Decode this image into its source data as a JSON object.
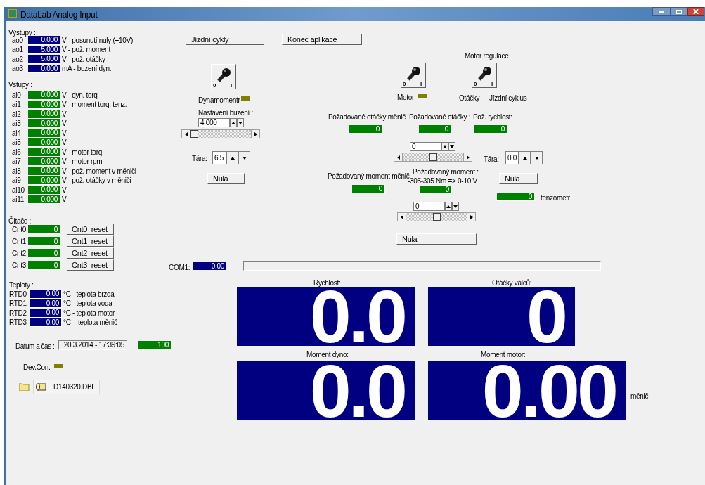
{
  "window": {
    "title": "DataLab Analog Input"
  },
  "outputs": {
    "heading": "Výstupy :",
    "rows": [
      {
        "name": "ao0",
        "value": "0.000",
        "unit": "V - posunutí nuly (+10V)"
      },
      {
        "name": "ao1",
        "value": "5.000",
        "unit": "V - pož. moment"
      },
      {
        "name": "ao2",
        "value": "5.000",
        "unit": "V - pož. otáčky"
      },
      {
        "name": "ao3",
        "value": "0.000",
        "unit": "mA - buzení dyn."
      }
    ]
  },
  "inputs": {
    "heading": "Vstupy :",
    "rows": [
      {
        "name": "ai0",
        "value": "0.000",
        "unit": "V - dyn. torq"
      },
      {
        "name": "ai1",
        "value": "0.000",
        "unit": "V - moment torq. tenz."
      },
      {
        "name": "ai2",
        "value": "0.000",
        "unit": "V"
      },
      {
        "name": "ai3",
        "value": "0.000",
        "unit": "V"
      },
      {
        "name": "ai4",
        "value": "0.000",
        "unit": "V"
      },
      {
        "name": "ai5",
        "value": "0.000",
        "unit": "V"
      },
      {
        "name": "ai6",
        "value": "0.000",
        "unit": "V - motor torq"
      },
      {
        "name": "ai7",
        "value": "0.000",
        "unit": "V - motor rpm"
      },
      {
        "name": "ai8",
        "value": "0.000",
        "unit": "V - pož. moment v měniči"
      },
      {
        "name": "ai9",
        "value": "0.000",
        "unit": "V - pož. otáčky v měniči"
      },
      {
        "name": "ai10",
        "value": "0.000",
        "unit": "V"
      },
      {
        "name": "ai11",
        "value": "0.000",
        "unit": "V"
      }
    ]
  },
  "counters": {
    "heading": "Čítače :",
    "rows": [
      {
        "name": "Cnt0",
        "value": "0",
        "button": "Cnt0_reset"
      },
      {
        "name": "Cnt1",
        "value": "0",
        "button": "Cnt1_reset"
      },
      {
        "name": "Cnt2",
        "value": "0",
        "button": "Cnt2_reset"
      },
      {
        "name": "Cnt3",
        "value": "0",
        "button": "Cnt3_reset"
      }
    ]
  },
  "temperatures": {
    "heading": "Teploty :",
    "rows": [
      {
        "name": "RTD0",
        "value": "0.00",
        "unit": "°C - teplota brzda"
      },
      {
        "name": "RTD1",
        "value": "0.00",
        "unit": "°C - teplota voda"
      },
      {
        "name": "RTD2",
        "value": "0.00",
        "unit": "°C - teplota motor"
      },
      {
        "name": "RTD3",
        "value": "0.00",
        "unit": "°C  - teplota měnič"
      }
    ]
  },
  "datetime": {
    "label": "Datum a čas :",
    "value": "20.3.2014 - 17:39:05",
    "counter": "100"
  },
  "device": {
    "label": "Dev.Con.",
    "on": false
  },
  "file": {
    "name": "D140320.DBF"
  },
  "buttons": [
    {
      "label": "Jízdní cykly"
    },
    {
      "label": "Konec aplikace"
    }
  ],
  "dynamometer": {
    "switch": {
      "on": false,
      "off_label": "0",
      "on_label": "I"
    },
    "label": "Dynamomentr",
    "on": false,
    "excitation_label": "Nastavení buzení :",
    "excitation_value": "4.000",
    "tare_label": "Tára:",
    "tare_value": "6.5",
    "zero_button": "Nula"
  },
  "motor": {
    "regulation_label": "Motor regulace",
    "switch": {
      "on": false,
      "off_label": "0",
      "on_label": "I"
    },
    "regulation_switch": {
      "on": false,
      "off_label": "0",
      "on_label": "I"
    },
    "label": "Motor",
    "on": false,
    "mode_labels": [
      "Otáčky",
      "Jízdní cyklus"
    ]
  },
  "readouts": [
    {
      "label": "Požadované otáčky měnič",
      "value": "0"
    },
    {
      "label": "Požadované otáčky :",
      "value": "0"
    },
    {
      "label": "Pož. rychlost:",
      "value": "0"
    }
  ],
  "speed_setpoint": {
    "value": "0"
  },
  "tare": {
    "label": "Tára:",
    "value": "0.0"
  },
  "torque": {
    "inverter_label": "Požadovaný moment měnič",
    "inverter_value": "0",
    "label": "Požadovaný moment :",
    "range": "-305-305 Nm => 0-10 V",
    "value": "0",
    "setpoint": "0",
    "zero_button": "Nula"
  },
  "tenzometer": {
    "zero_button": "Nula",
    "value": "0",
    "label": "tenzometr"
  },
  "com": {
    "label": "COM1:",
    "value": "0.00"
  },
  "displays": [
    {
      "label": "Rychlost:",
      "value": "0.0"
    },
    {
      "label": "Otáčky válců:",
      "value": "0"
    },
    {
      "label": "Moment dyno:",
      "value": "0.0"
    },
    {
      "label": "Moment motor:",
      "value": "0.00",
      "suffix": "měnič"
    }
  ]
}
